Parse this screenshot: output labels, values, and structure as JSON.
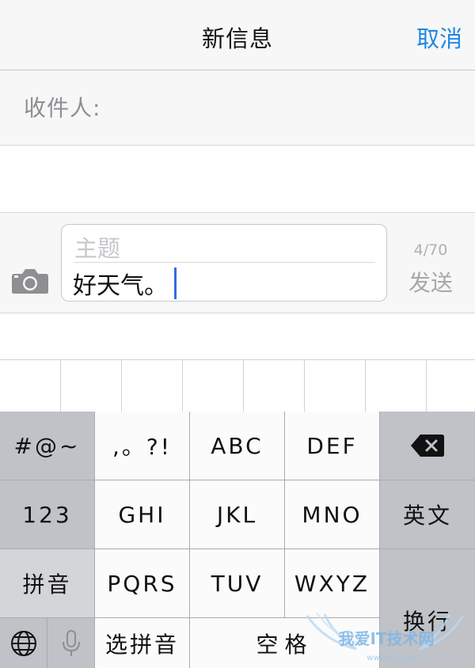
{
  "navbar": {
    "title": "新信息",
    "cancel_label": "取消"
  },
  "recipient": {
    "label": "收件人:"
  },
  "compose": {
    "subject_placeholder": "主题",
    "body_text": "好天气。",
    "char_count": "4/70",
    "send_label": "发送",
    "camera_icon": "camera-icon"
  },
  "keyboard": {
    "row1": {
      "symbols": "#@~",
      "punct": ",。?!",
      "abc": "ABC",
      "def": "DEF",
      "delete_icon": "backspace-icon"
    },
    "row2": {
      "num": "123",
      "ghi": "GHI",
      "jkl": "JKL",
      "mno": "MNO",
      "english": "英文"
    },
    "row3": {
      "pinyin": "拼音",
      "pqrs": "PQRS",
      "tuv": "TUV",
      "wxyz": "WXYZ"
    },
    "row4": {
      "globe_icon": "globe-icon",
      "mic_icon": "microphone-icon",
      "select_pinyin": "选拼音",
      "space": "空格",
      "return": "换行"
    }
  },
  "watermark": {
    "text": "我爱IT技术网",
    "url": "www.52ij.com"
  },
  "colors": {
    "accent": "#1e88e5",
    "caret": "#2f6fe0",
    "keyboard_bg": "#bcbfc4"
  }
}
